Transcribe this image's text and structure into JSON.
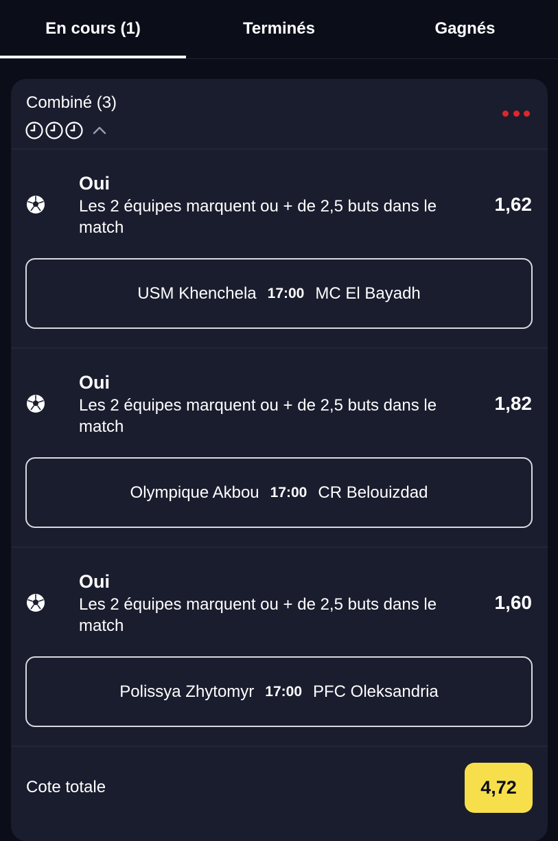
{
  "tabs": [
    {
      "label": "En cours (1)",
      "active": true
    },
    {
      "label": "Terminés",
      "active": false
    },
    {
      "label": "Gagnés",
      "active": false
    }
  ],
  "bet": {
    "title": "Combiné (3)",
    "status_icons": [
      "clock-icon",
      "clock-icon",
      "clock-icon"
    ],
    "toggle_icon": "chevron-up-icon",
    "menu_icon": "more-icon",
    "menu_color": "#e0262c",
    "selections": [
      {
        "icon": "soccer-ball-icon",
        "choice": "Oui",
        "market": "Les 2 équipes marquent ou + de 2,5 buts dans le match",
        "odds": "1,62",
        "home": "USM Khenchela",
        "time": "17:00",
        "away": "MC El Bayadh"
      },
      {
        "icon": "soccer-ball-icon",
        "choice": "Oui",
        "market": "Les 2 équipes marquent ou + de 2,5 buts dans le match",
        "odds": "1,82",
        "home": "Olympique Akbou",
        "time": "17:00",
        "away": "CR Belouizdad"
      },
      {
        "icon": "soccer-ball-icon",
        "choice": "Oui",
        "market": "Les 2 équipes marquent ou + de 2,5 buts dans le match",
        "odds": "1,60",
        "home": "Polissya Zhytomyr",
        "time": "17:00",
        "away": "PFC Oleksandria"
      }
    ],
    "total_label": "Cote totale",
    "total_odds": "4,72",
    "total_color": "#f7df4c"
  }
}
